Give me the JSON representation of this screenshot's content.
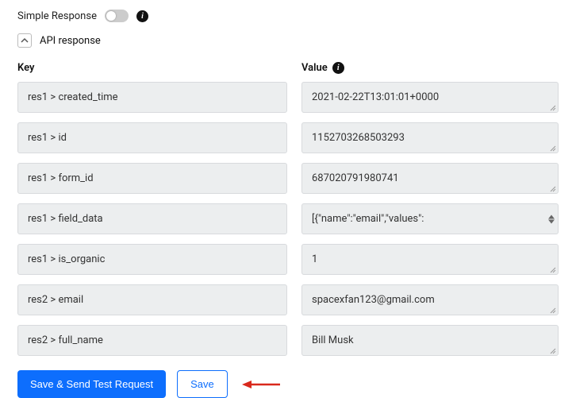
{
  "top": {
    "simple_response_label": "Simple Response",
    "toggle_on": false
  },
  "section": {
    "title": "API response"
  },
  "headers": {
    "key": "Key",
    "value": "Value"
  },
  "rows": [
    {
      "key": "res1 > created_time",
      "value": "2021-02-22T13:01:01+0000",
      "multiline": false
    },
    {
      "key": "res1 > id",
      "value": "1152703268503293",
      "multiline": false
    },
    {
      "key": "res1 > form_id",
      "value": "687020791980741",
      "multiline": false
    },
    {
      "key": "res1 > field_data",
      "value": "[{\"name\":\"email\",\"values\":",
      "multiline": true
    },
    {
      "key": "res1 > is_organic",
      "value": "1",
      "multiline": false
    },
    {
      "key": "res2 > email",
      "value": "spacexfan123@gmail.com",
      "multiline": false
    },
    {
      "key": "res2 > full_name",
      "value": "Bill Musk",
      "multiline": false
    }
  ],
  "buttons": {
    "save_send": "Save & Send Test Request",
    "save": "Save"
  }
}
